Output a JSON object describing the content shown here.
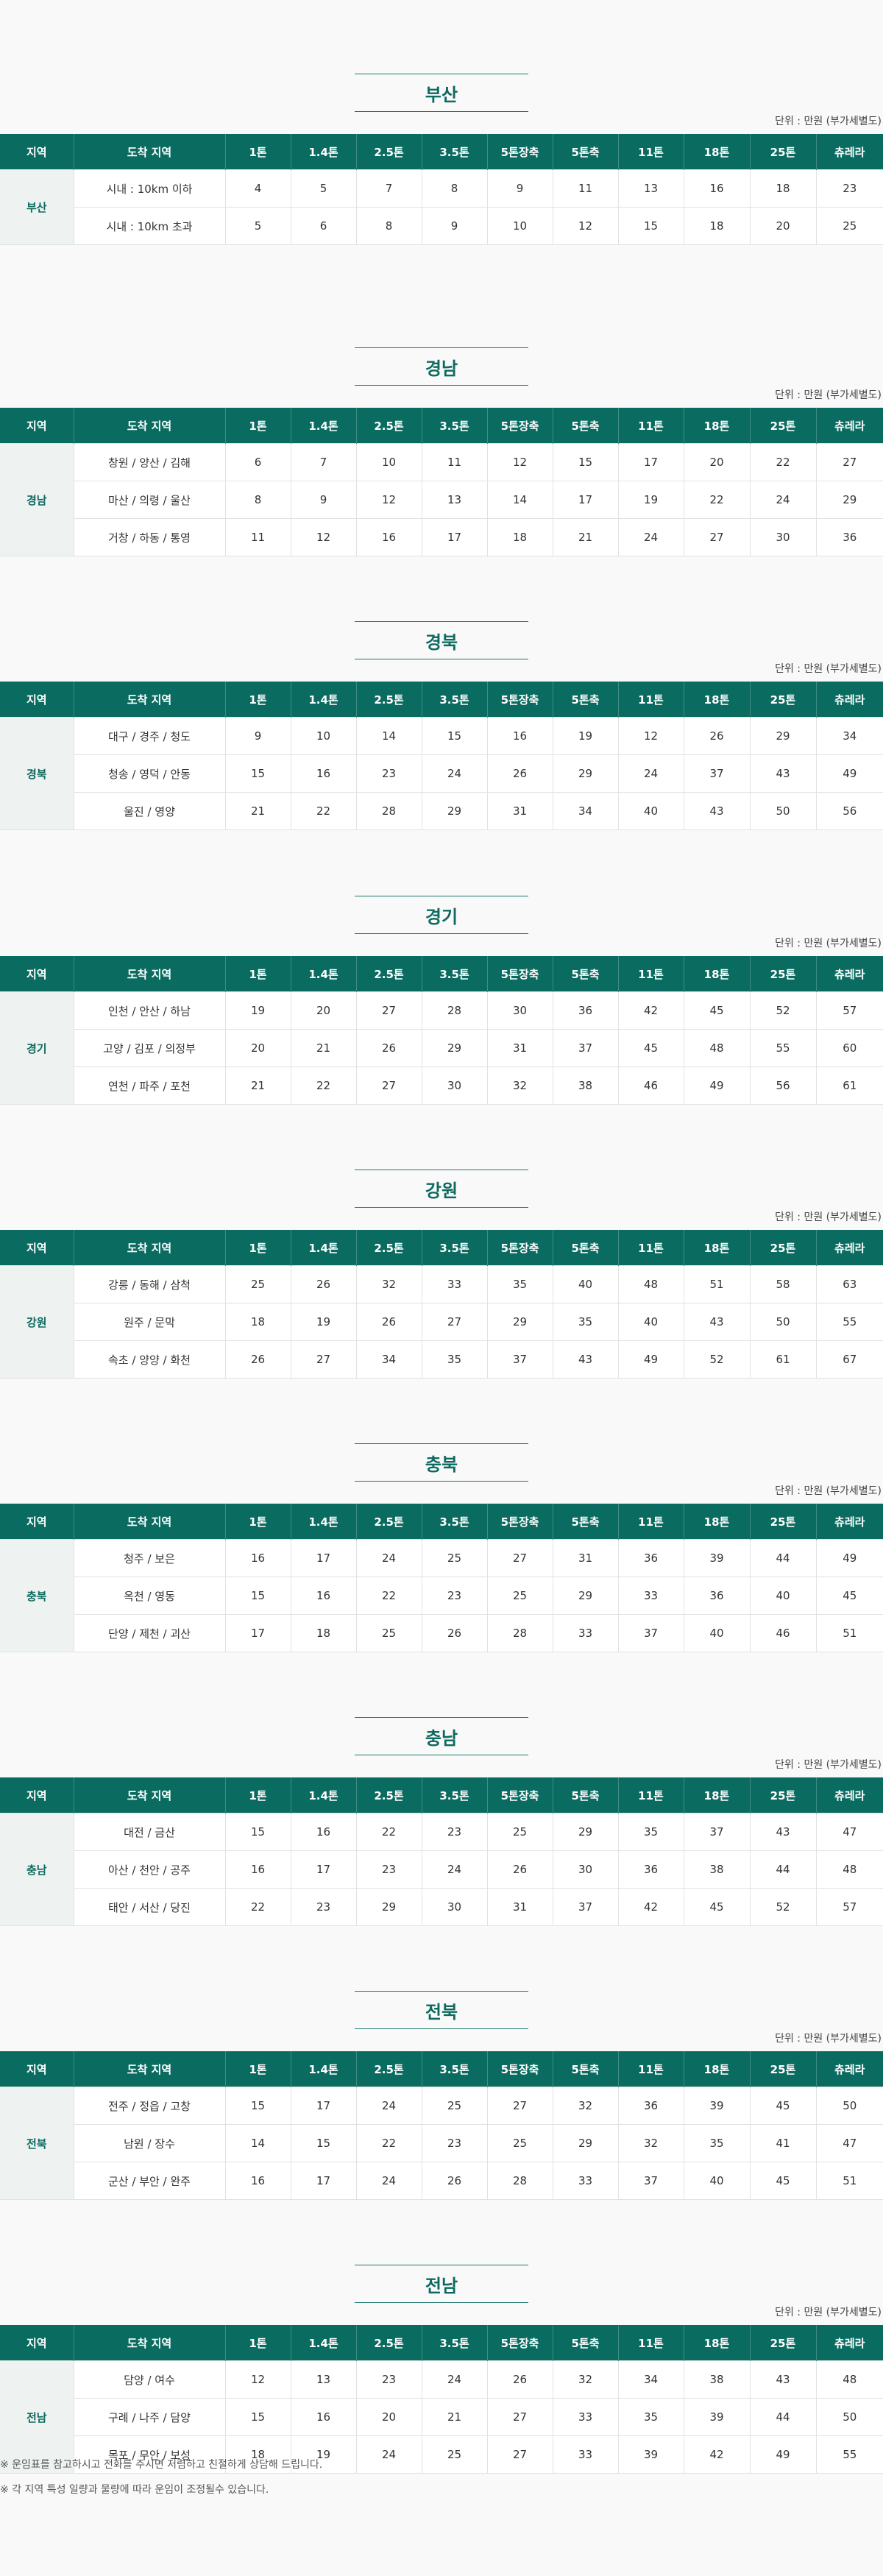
{
  "unit_label": "단위 : 만원 (부가세별도)",
  "headers": [
    "지역",
    "도착 지역",
    "1톤",
    "1.4톤",
    "2.5톤",
    "3.5톤",
    "5톤장축",
    "5톤축",
    "11톤",
    "18톤",
    "25톤",
    "츄레라"
  ],
  "sections": [
    {
      "title": "부산",
      "region": "부산",
      "rows": [
        {
          "destination": "시내 : 10km 이하",
          "values": [
            "4",
            "5",
            "7",
            "8",
            "9",
            "11",
            "13",
            "16",
            "18",
            "23"
          ]
        },
        {
          "destination": "시내 : 10km 초과",
          "values": [
            "5",
            "6",
            "8",
            "9",
            "10",
            "12",
            "15",
            "18",
            "20",
            "25"
          ]
        }
      ]
    },
    {
      "title": "경남",
      "region": "경남",
      "rows": [
        {
          "destination": "창원 / 양산 / 김해",
          "values": [
            "6",
            "7",
            "10",
            "11",
            "12",
            "15",
            "17",
            "20",
            "22",
            "27"
          ]
        },
        {
          "destination": "마산 / 의령 / 울산",
          "values": [
            "8",
            "9",
            "12",
            "13",
            "14",
            "17",
            "19",
            "22",
            "24",
            "29"
          ]
        },
        {
          "destination": "거창 / 하동 / 통영",
          "values": [
            "11",
            "12",
            "16",
            "17",
            "18",
            "21",
            "24",
            "27",
            "30",
            "36"
          ]
        }
      ]
    },
    {
      "title": "경북",
      "region": "경북",
      "rows": [
        {
          "destination": "대구 / 경주 / 청도",
          "values": [
            "9",
            "10",
            "14",
            "15",
            "16",
            "19",
            "12",
            "26",
            "29",
            "34"
          ]
        },
        {
          "destination": "청송 / 영덕 / 안동",
          "values": [
            "15",
            "16",
            "23",
            "24",
            "26",
            "29",
            "24",
            "37",
            "43",
            "49"
          ]
        },
        {
          "destination": "울진 / 영양",
          "values": [
            "21",
            "22",
            "28",
            "29",
            "31",
            "34",
            "40",
            "43",
            "50",
            "56"
          ]
        }
      ]
    },
    {
      "title": "경기",
      "region": "경기",
      "rows": [
        {
          "destination": "인천 / 안산 / 하남",
          "values": [
            "19",
            "20",
            "27",
            "28",
            "30",
            "36",
            "42",
            "45",
            "52",
            "57"
          ]
        },
        {
          "destination": "고양 / 김포 / 의정부",
          "values": [
            "20",
            "21",
            "26",
            "29",
            "31",
            "37",
            "45",
            "48",
            "55",
            "60"
          ]
        },
        {
          "destination": "연천 / 파주 / 포천",
          "values": [
            "21",
            "22",
            "27",
            "30",
            "32",
            "38",
            "46",
            "49",
            "56",
            "61"
          ]
        }
      ]
    },
    {
      "title": "강원",
      "region": "강원",
      "rows": [
        {
          "destination": "강릉 / 동해 / 삼척",
          "values": [
            "25",
            "26",
            "32",
            "33",
            "35",
            "40",
            "48",
            "51",
            "58",
            "63"
          ]
        },
        {
          "destination": "원주 / 문막",
          "values": [
            "18",
            "19",
            "26",
            "27",
            "29",
            "35",
            "40",
            "43",
            "50",
            "55"
          ]
        },
        {
          "destination": "속초 / 양양 / 화천",
          "values": [
            "26",
            "27",
            "34",
            "35",
            "37",
            "43",
            "49",
            "52",
            "61",
            "67"
          ]
        }
      ]
    },
    {
      "title": "충북",
      "region": "충북",
      "rows": [
        {
          "destination": "청주 / 보은",
          "values": [
            "16",
            "17",
            "24",
            "25",
            "27",
            "31",
            "36",
            "39",
            "44",
            "49"
          ]
        },
        {
          "destination": "옥천 / 영동",
          "values": [
            "15",
            "16",
            "22",
            "23",
            "25",
            "29",
            "33",
            "36",
            "40",
            "45"
          ]
        },
        {
          "destination": "단양 / 제천 / 괴산",
          "values": [
            "17",
            "18",
            "25",
            "26",
            "28",
            "33",
            "37",
            "40",
            "46",
            "51"
          ]
        }
      ]
    },
    {
      "title": "충남",
      "region": "충남",
      "rows": [
        {
          "destination": "대전 / 금산",
          "values": [
            "15",
            "16",
            "22",
            "23",
            "25",
            "29",
            "35",
            "37",
            "43",
            "47"
          ]
        },
        {
          "destination": "아산 / 천안 / 공주",
          "values": [
            "16",
            "17",
            "23",
            "24",
            "26",
            "30",
            "36",
            "38",
            "44",
            "48"
          ]
        },
        {
          "destination": "태안 / 서산 / 당진",
          "values": [
            "22",
            "23",
            "29",
            "30",
            "31",
            "37",
            "42",
            "45",
            "52",
            "57"
          ]
        }
      ]
    },
    {
      "title": "전북",
      "region": "전북",
      "rows": [
        {
          "destination": "전주 / 정읍 / 고창",
          "values": [
            "15",
            "17",
            "24",
            "25",
            "27",
            "32",
            "36",
            "39",
            "45",
            "50"
          ]
        },
        {
          "destination": "남원 / 장수",
          "values": [
            "14",
            "15",
            "22",
            "23",
            "25",
            "29",
            "32",
            "35",
            "41",
            "47"
          ]
        },
        {
          "destination": "군산 / 부안 / 완주",
          "values": [
            "16",
            "17",
            "24",
            "26",
            "28",
            "33",
            "37",
            "40",
            "45",
            "51"
          ]
        }
      ]
    },
    {
      "title": "전남",
      "region": "전남",
      "rows": [
        {
          "destination": "담양 / 여수",
          "values": [
            "12",
            "13",
            "23",
            "24",
            "26",
            "32",
            "34",
            "38",
            "43",
            "48"
          ]
        },
        {
          "destination": "구례 / 나주 / 담양",
          "values": [
            "15",
            "16",
            "20",
            "21",
            "27",
            "33",
            "35",
            "39",
            "44",
            "50"
          ]
        },
        {
          "destination": "목포 / 무안 / 보성",
          "values": [
            "18",
            "19",
            "24",
            "25",
            "27",
            "33",
            "39",
            "42",
            "49",
            "55"
          ]
        }
      ]
    }
  ],
  "notes": [
    "※ 운임표를 참고하시고 전화를 주시면 저렴하고 친절하게 상담해 드립니다.",
    "※ 각 지역 특성 일량과 물량에 따라 운임이 조정될수 있습니다."
  ]
}
